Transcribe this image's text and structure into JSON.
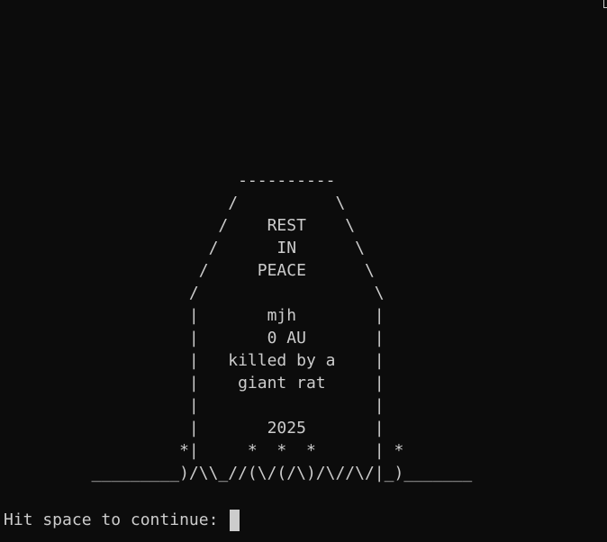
{
  "tombstone": {
    "lines": [
      "                        ----------",
      "                       /          \\",
      "                      /    REST    \\",
      "                     /      IN      \\",
      "                    /     PEACE      \\",
      "                   /                  \\",
      "                   |       mjh        |",
      "                   |       0 AU       |",
      "                   |   killed by a    |",
      "                   |    giant rat     |",
      "                   |                  |",
      "                   |       2025       |",
      "                  *|     *  *  *      | *",
      "         _________)/\\\\_//(\\/(/\\)/\\//\\/|_)_______"
    ]
  },
  "prompt": {
    "text": "Hit space to continue: "
  },
  "colors": {
    "background": "#0c0c0c",
    "foreground": "#cccccc"
  }
}
